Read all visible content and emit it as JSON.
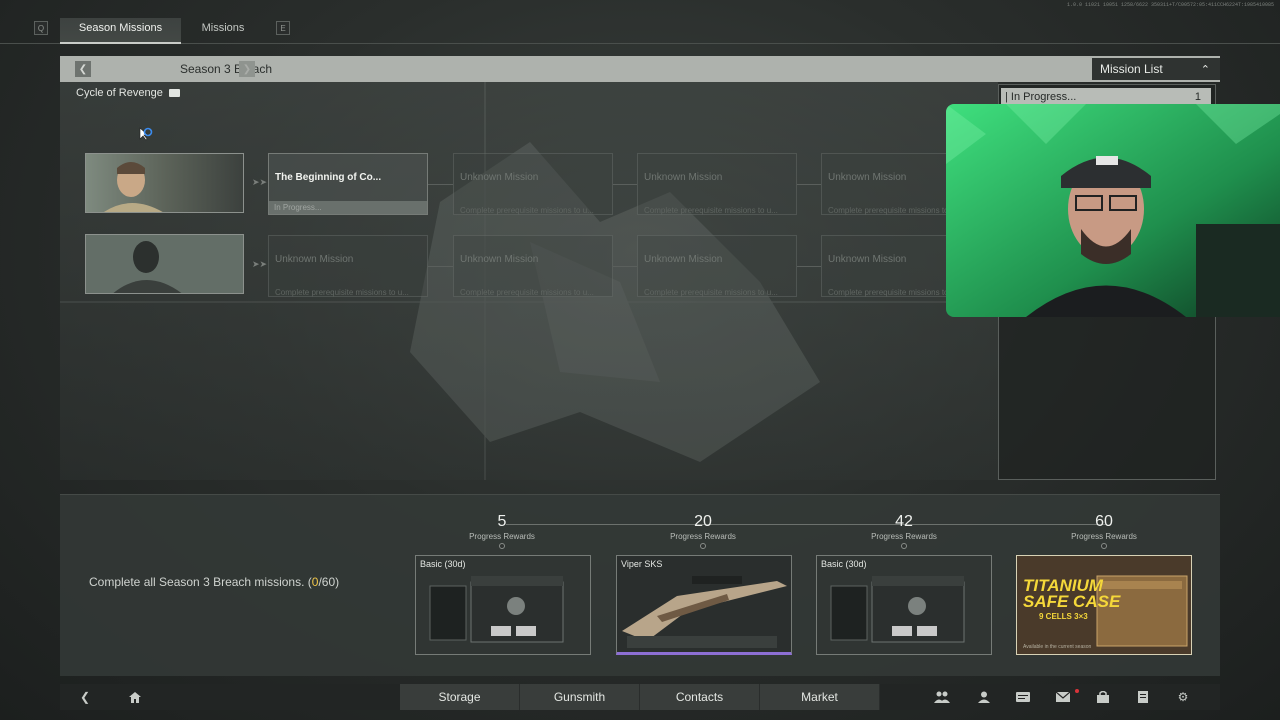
{
  "top_tabs": {
    "left_key": "Q",
    "right_key": "E",
    "tabs": [
      {
        "label": "Season Missions",
        "active": true
      },
      {
        "label": "Missions",
        "active": false
      }
    ],
    "hud_text": "1.0.0 11021 10051 1258/6622 350311+T/C00572:05:411CCH6224T:1985410085"
  },
  "header": {
    "season_title": "Season 3 Breach",
    "mission_list_label": "Mission List"
  },
  "cycle": {
    "label": "Cycle of Revenge"
  },
  "mission_rows": [
    {
      "cards": [
        {
          "name": "The Beginning of Co...",
          "status": "In Progress...",
          "state": "active"
        },
        {
          "name": "Unknown Mission",
          "desc": "Complete prerequisite missions to u...",
          "state": "locked"
        },
        {
          "name": "Unknown Mission",
          "desc": "Complete prerequisite missions to u...",
          "state": "locked"
        },
        {
          "name": "Unknown Mission",
          "desc": "Complete prerequisite missions to u...",
          "state": "locked"
        }
      ]
    },
    {
      "cards": [
        {
          "name": "Unknown Mission",
          "desc": "Complete prerequisite missions to u...",
          "state": "locked"
        },
        {
          "name": "Unknown Mission",
          "desc": "Complete prerequisite missions to u...",
          "state": "locked"
        },
        {
          "name": "Unknown Mission",
          "desc": "Complete prerequisite missions to u...",
          "state": "locked"
        },
        {
          "name": "Unknown Mission",
          "desc": "Complete prerequisite missions to u...",
          "state": "locked"
        }
      ]
    }
  ],
  "mission_list": {
    "filter_label": "| In Progress...",
    "filter_count": "1"
  },
  "rewards": {
    "complete_text_pre": "Complete all Season 3 Breach missions. (",
    "complete_current": "0",
    "complete_text_post": "/60)",
    "progress_label": "Progress Rewards",
    "tiers": [
      {
        "threshold": "5",
        "reward": "Basic (30d)"
      },
      {
        "threshold": "20",
        "reward": "Viper SKS"
      },
      {
        "threshold": "42",
        "reward": "Basic (30d)"
      },
      {
        "threshold": "60",
        "reward": "Titanium Safe Case",
        "art_title": "TITANIUM",
        "art_title2": "SAFE CASE",
        "art_sub": "9 CELLS 3×3",
        "art_foot": "Available in the current season"
      }
    ]
  },
  "bottom_nav": {
    "tabs": [
      "Storage",
      "Gunsmith",
      "Contacts",
      "Market"
    ],
    "icons": [
      "back-icon",
      "home-icon",
      "squad-icon",
      "profile-icon",
      "chat-icon",
      "mail-icon",
      "safe-icon",
      "notes-icon",
      "settings-icon"
    ]
  },
  "colors": {
    "accent_yellow": "#f0c64a",
    "purple_rarity": "#8d6fd4",
    "webcam_green": "#2ecf6a"
  }
}
